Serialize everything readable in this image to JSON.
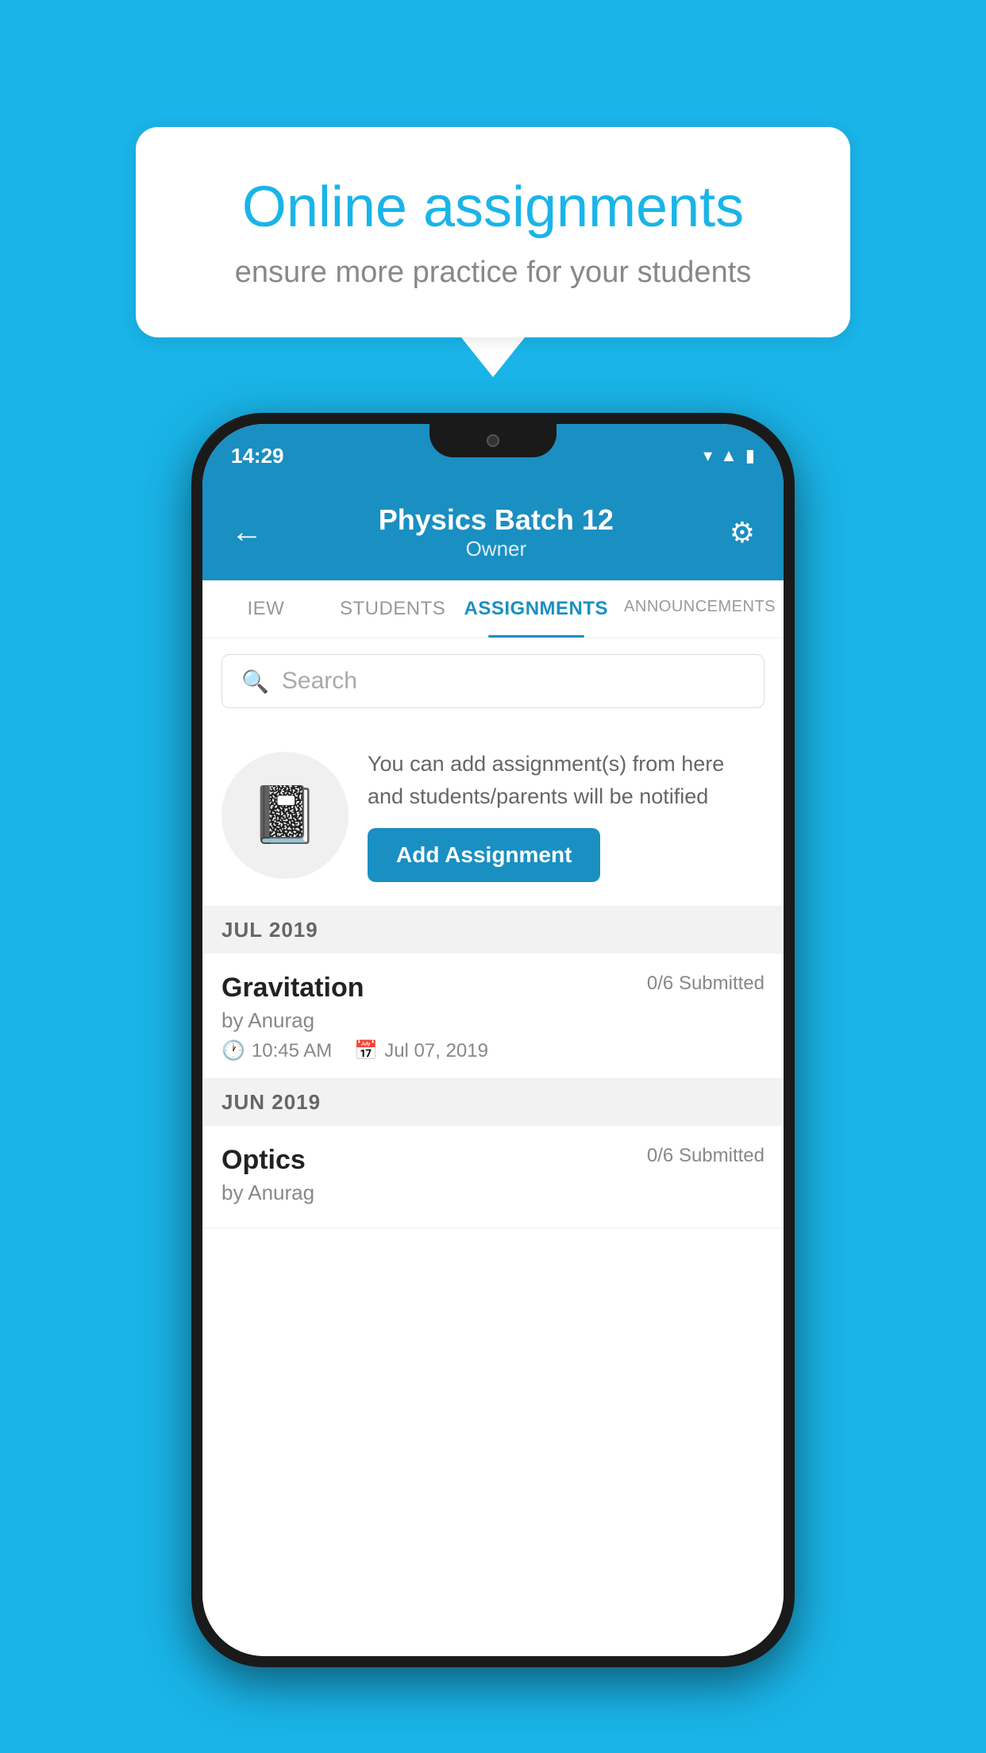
{
  "background": {
    "color": "#1ab4e8"
  },
  "speech_bubble": {
    "title": "Online assignments",
    "subtitle": "ensure more practice for your students"
  },
  "phone": {
    "status_bar": {
      "time": "14:29",
      "icons": [
        "wifi",
        "signal",
        "battery"
      ]
    },
    "header": {
      "back_label": "←",
      "title": "Physics Batch 12",
      "subtitle": "Owner",
      "settings_label": "⚙"
    },
    "tabs": [
      {
        "label": "IEW",
        "active": false
      },
      {
        "label": "STUDENTS",
        "active": false
      },
      {
        "label": "ASSIGNMENTS",
        "active": true
      },
      {
        "label": "ANNOUNCEMENTS",
        "active": false
      }
    ],
    "search": {
      "placeholder": "Search"
    },
    "promo": {
      "description": "You can add assignment(s) from here and students/parents will be notified",
      "button_label": "Add Assignment"
    },
    "sections": [
      {
        "month": "JUL 2019",
        "assignments": [
          {
            "name": "Gravitation",
            "submitted": "0/6 Submitted",
            "author": "by Anurag",
            "time": "10:45 AM",
            "date": "Jul 07, 2019"
          }
        ]
      },
      {
        "month": "JUN 2019",
        "assignments": [
          {
            "name": "Optics",
            "submitted": "0/6 Submitted",
            "author": "by Anurag",
            "time": "",
            "date": ""
          }
        ]
      }
    ]
  }
}
